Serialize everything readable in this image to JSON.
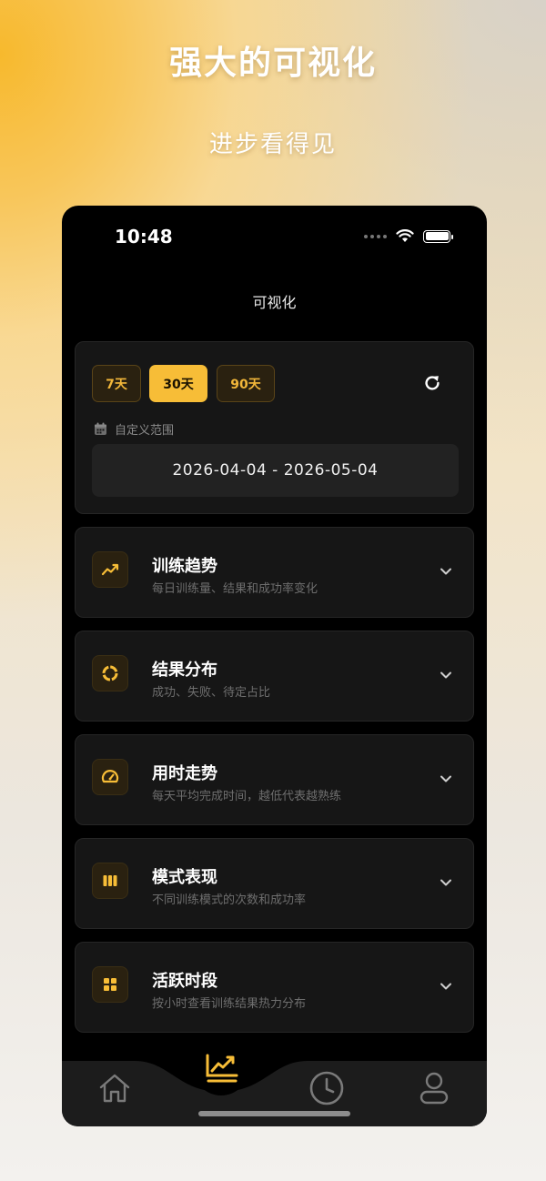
{
  "promo": {
    "title": "强大的可视化",
    "subtitle": "进步看得见"
  },
  "status_bar": {
    "time": "10:48"
  },
  "nav": {
    "title": "可视化"
  },
  "filter": {
    "ranges": [
      {
        "label": "7天",
        "selected": false
      },
      {
        "label": "30天",
        "selected": true
      },
      {
        "label": "90天",
        "selected": false
      }
    ],
    "custom_label": "自定义范围",
    "date_range": "2026-04-04 - 2026-05-04"
  },
  "sections": [
    {
      "title": "训练趋势",
      "desc": "每日训练量、结果和成功率变化",
      "icon": "trend-icon"
    },
    {
      "title": "结果分布",
      "desc": "成功、失败、待定占比",
      "icon": "ring-icon"
    },
    {
      "title": "用时走势",
      "desc": "每天平均完成时间，越低代表越熟练",
      "icon": "gauge-icon"
    },
    {
      "title": "模式表现",
      "desc": "不同训练模式的次数和成功率",
      "icon": "bars-icon"
    },
    {
      "title": "活跃时段",
      "desc": "按小时查看训练结果热力分布",
      "icon": "grid-icon"
    }
  ],
  "tabbar": {
    "items": [
      "home-icon",
      "chart-icon",
      "clock-icon",
      "user-icon"
    ],
    "active": "chart-icon"
  },
  "colors": {
    "accent": "#f7bd37",
    "background": "#000000",
    "card": "#161616"
  }
}
